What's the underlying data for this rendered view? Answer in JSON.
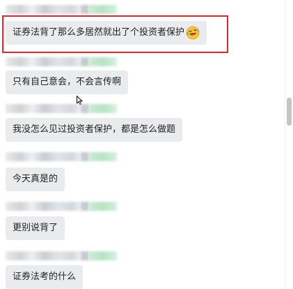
{
  "messages": [
    {
      "text": "证券法背了那么多居然就出了个投资者保护",
      "emoji": "rolling-on-floor-laughing-icon"
    },
    {
      "text": "只有自己意会，不会言传啊"
    },
    {
      "text": "我没怎么见过投资者保护，都是怎么做题"
    },
    {
      "text": "今天真是的"
    },
    {
      "text": "更别说背了"
    },
    {
      "text": "证券法考的什么"
    }
  ],
  "colors": {
    "bubble": "#e9ebec",
    "highlight": "#e0252b",
    "text": "#1f1f1f"
  }
}
